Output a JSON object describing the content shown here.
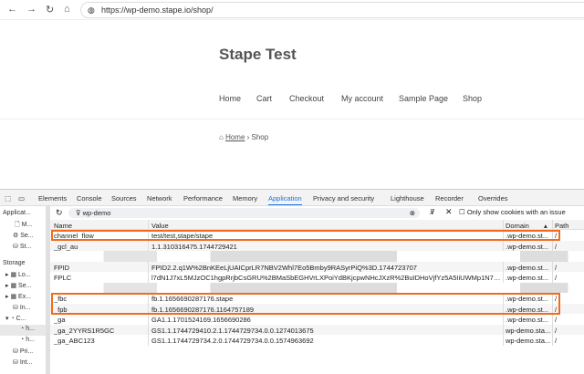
{
  "browser": {
    "url": "https://wp-demo.stape.io/shop/"
  },
  "site": {
    "title": "Stape Test",
    "nav": [
      "Home",
      "Cart",
      "Checkout",
      "My account",
      "Sample Page",
      "Shop"
    ],
    "breadcrumb": {
      "home": "Home",
      "current": "Shop"
    }
  },
  "devtools": {
    "tabs": [
      "Elements",
      "Console",
      "Sources",
      "Network",
      "Performance",
      "Memory",
      "Application",
      "Privacy and security",
      "Lighthouse",
      "Recorder",
      "Overrides"
    ],
    "active_tab": "Application",
    "sidebar": {
      "application_label": "Applicat...",
      "items": [
        "M...",
        "Se...",
        "St..."
      ],
      "storage_label": "Storage",
      "storage_items": [
        "Lo...",
        "Se...",
        "Ex...",
        "In...",
        "C...",
        "h...",
        "h...",
        "Pri...",
        "Int..."
      ]
    },
    "filter": {
      "value": "wp-demo",
      "issue_checkbox_label": "Only show cookies with an issue"
    },
    "columns": {
      "name": "Name",
      "value": "Value",
      "domain": "Domain",
      "path": "Path"
    },
    "cookies": [
      {
        "name": "channel_flow",
        "value": "test/test,stape/stape",
        "domain": ".wp-demo.st...",
        "path": "/",
        "highlight": true
      },
      {
        "name": "_gcl_au",
        "value": "1.1.310316475.1744729421",
        "domain": ".wp-demo.st...",
        "path": "/"
      },
      {
        "name": "",
        "value": "",
        "domain": "",
        "path": "",
        "blurred": true
      },
      {
        "name": "FPID",
        "value": "FPID2.2.q1W%2BnKEeLjUAICprLR7NBV2Whl7Eo5Bmby9RASyrPiQ%3D.1744723707",
        "domain": ".wp-demo.st...",
        "path": "/"
      },
      {
        "name": "FPLC",
        "value": "l7dN1J7xL5MJzOC1hgpRrjbCsGRU%2BMaSbEGHVrLXPoiYdBKjcpwNHcJXzR%2BuIDHoVjfYz5A5IiUWMp1N7d%2Feij...",
        "domain": ".wp-demo.st...",
        "path": "/"
      },
      {
        "name": "",
        "value": "",
        "domain": "",
        "path": "",
        "blurred": true
      },
      {
        "name": "_fbc",
        "value": "fb.1.1656690287176.stape",
        "domain": ".wp-demo.st...",
        "path": "/",
        "highlight": true
      },
      {
        "name": "_fpb",
        "value": "fb.1.1656690287176.1164757189",
        "domain": ".wp-demo.st...",
        "path": "/",
        "highlight": true
      },
      {
        "name": "_ga",
        "value": "GA1.1.1701524169.1656690286",
        "domain": ".wp-demo.st...",
        "path": "/"
      },
      {
        "name": "_ga_2YYRS1R5GC",
        "value": "GS1.1.1744729410.2.1.1744729734.0.0.1274013675",
        "domain": "wp-demo.sta...",
        "path": "/"
      },
      {
        "name": "_ga_ABC123",
        "value": "GS1.1.1744729734.2.0.1744729734.0.0.1574963692",
        "domain": "wp-demo.sta...",
        "path": "/"
      }
    ],
    "highlight_color": "#f26b1d"
  }
}
